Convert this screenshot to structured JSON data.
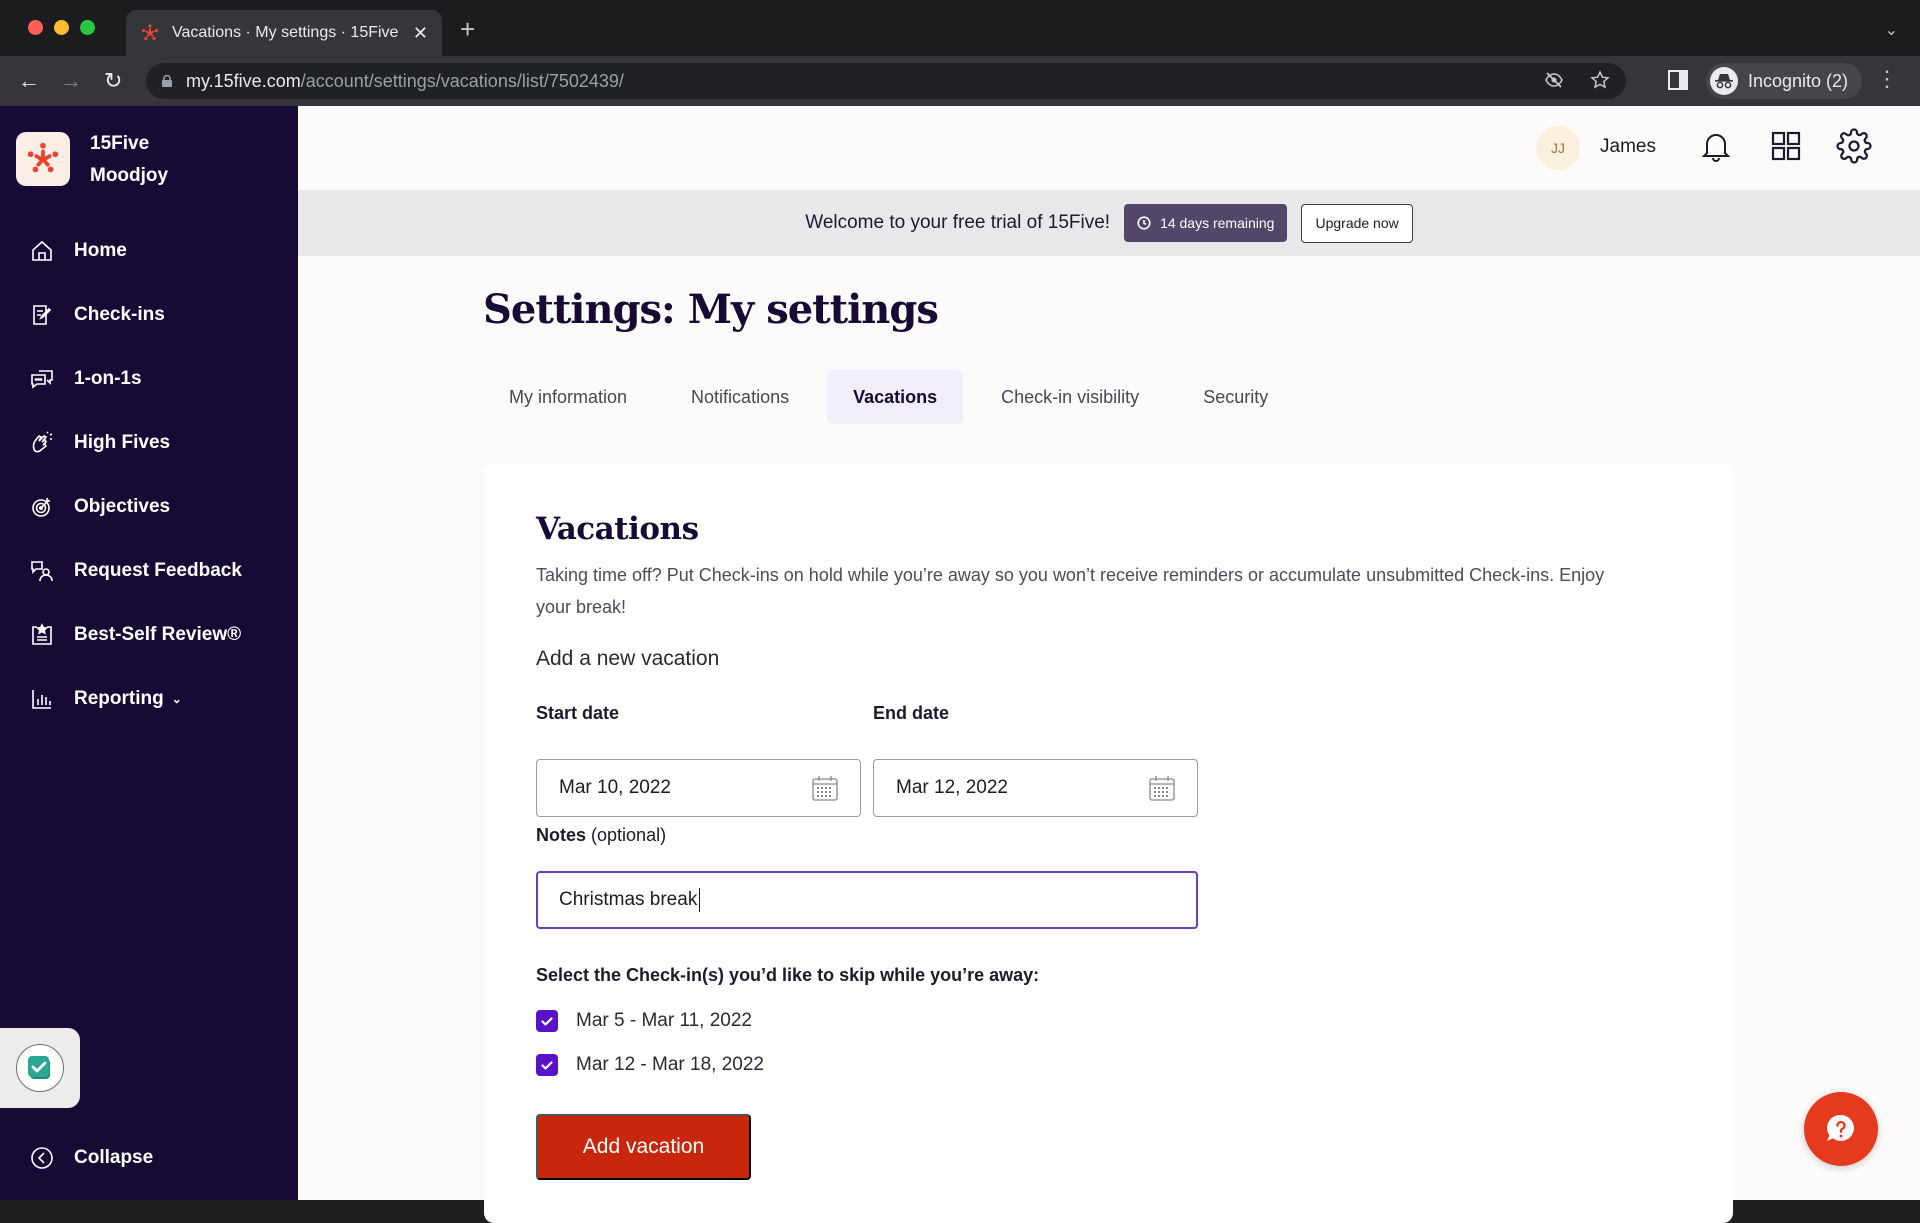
{
  "browser": {
    "tab_title": "Vacations · My settings · 15Five",
    "url_host": "my.15five.com",
    "url_path": "/account/settings/vacations/list/7502439/",
    "incognito_label": "Incognito (2)"
  },
  "sidebar": {
    "brand_line1": "15Five",
    "brand_line2": "Moodjoy",
    "items": [
      {
        "label": "Home",
        "icon": "home-icon"
      },
      {
        "label": "Check-ins",
        "icon": "checkins-icon"
      },
      {
        "label": "1-on-1s",
        "icon": "chat-bubbles-icon"
      },
      {
        "label": "High Fives",
        "icon": "high-five-icon"
      },
      {
        "label": "Objectives",
        "icon": "target-icon"
      },
      {
        "label": "Request Feedback",
        "icon": "request-feedback-icon"
      },
      {
        "label": "Best-Self Review®",
        "icon": "review-star-icon"
      },
      {
        "label": "Reporting",
        "icon": "bar-chart-icon",
        "has_dropdown": true
      }
    ],
    "collapse_label": "Collapse"
  },
  "topbar": {
    "user_initials": "JJ",
    "user_name": "James"
  },
  "trial_banner": {
    "message": "Welcome to your free trial of 15Five!",
    "days_badge": "14 days remaining",
    "upgrade_label": "Upgrade now"
  },
  "page": {
    "title": "Settings: My settings",
    "tabs": [
      {
        "label": "My information",
        "active": false
      },
      {
        "label": "Notifications",
        "active": false
      },
      {
        "label": "Vacations",
        "active": true
      },
      {
        "label": "Check-in visibility",
        "active": false
      },
      {
        "label": "Security",
        "active": false
      }
    ]
  },
  "vacations": {
    "title": "Vacations",
    "description": "Taking time off? Put Check-ins on hold while you’re away so you won’t receive reminders or accumulate unsubmitted Check-ins. Enjoy your break!",
    "add_heading": "Add a new vacation",
    "start_label": "Start date",
    "start_value": "Mar 10, 2022",
    "end_label": "End date",
    "end_value": "Mar 12, 2022",
    "notes_label": "Notes",
    "notes_optional": "(optional)",
    "notes_value": "Christmas break",
    "skip_label": "Select the Check-in(s) you’d like to skip while you’re away:",
    "checkins": [
      {
        "label": "Mar 5 - Mar 11, 2022",
        "checked": true
      },
      {
        "label": "Mar 12 - Mar 18, 2022",
        "checked": true
      }
    ],
    "submit_label": "Add vacation"
  },
  "colors": {
    "sidebar_bg": "#170b35",
    "accent_red": "#c9270b",
    "checkbox_purple": "#5a12c9",
    "focus_border": "#6b3fb8",
    "badge_bg": "#534769"
  }
}
